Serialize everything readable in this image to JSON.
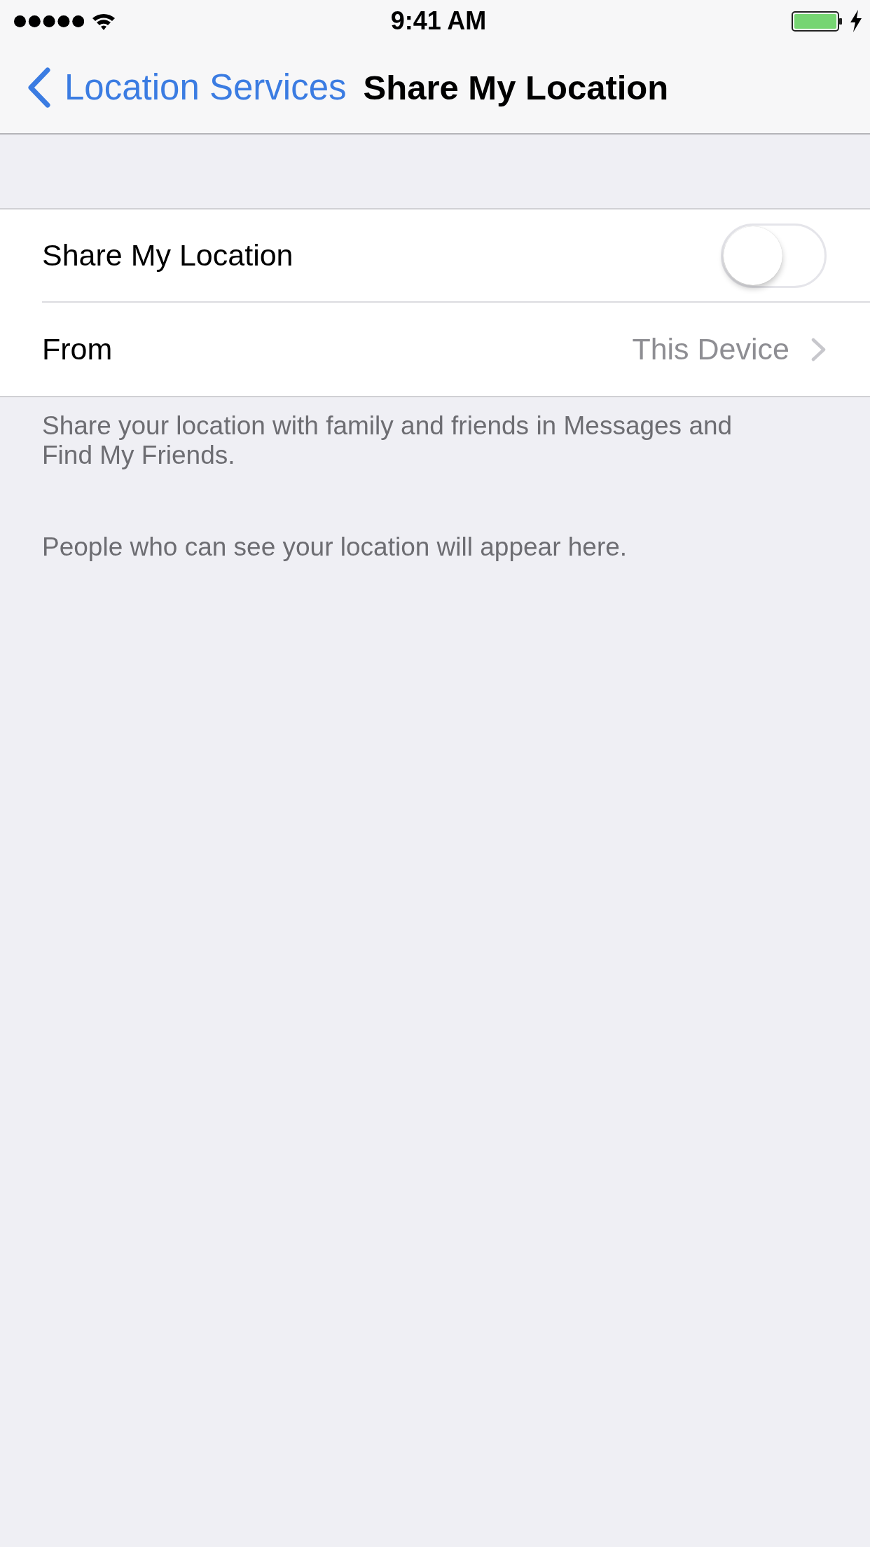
{
  "status_bar": {
    "time": "9:41 AM"
  },
  "nav_bar": {
    "back_label": "Location Services",
    "title": "Share My Location"
  },
  "settings": [
    {
      "kind": "toggle",
      "label": "Share My Location",
      "on": false
    },
    {
      "kind": "link",
      "label": "From",
      "value": "This Device"
    }
  ],
  "footer": "Share your location with family and friends in Messages and Find My Friends.",
  "people_note": "People who can see your location will appear here."
}
